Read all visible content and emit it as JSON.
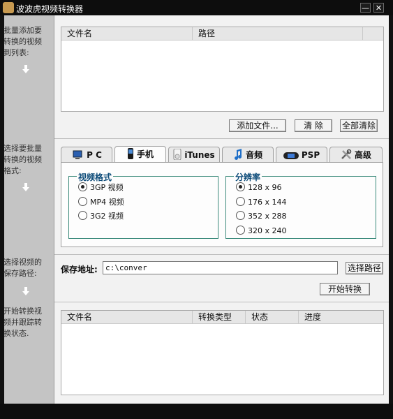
{
  "window": {
    "title": "波波虎视频转换器",
    "minimize_label": "—",
    "close_label": "✕"
  },
  "guide": {
    "step1": "批量添加要转换的视频到列表:",
    "step2": "选择要批量转换的视频格式:",
    "step3": "选择视频的保存路径:",
    "step4": "开始转换视频并跟踪转换状态."
  },
  "file_list": {
    "columns": [
      "文件名",
      "路径"
    ],
    "rows": []
  },
  "buttons": {
    "add_file": "添加文件...",
    "clear": "清  除",
    "clear_all": "全部清除",
    "choose_path": "选择路径",
    "start_convert": "开始转换"
  },
  "tabs": [
    {
      "label": "P C",
      "icon": "pc-icon"
    },
    {
      "label": "手机",
      "icon": "phone-icon"
    },
    {
      "label": "iTunes",
      "icon": "ipod-icon"
    },
    {
      "label": "音频",
      "icon": "music-note-icon"
    },
    {
      "label": "PSP",
      "icon": "psp-icon"
    },
    {
      "label": "高级",
      "icon": "tools-icon"
    }
  ],
  "active_tab": "手机",
  "video_format": {
    "title": "视频格式",
    "options": [
      "3GP 视频",
      "MP4 视频",
      "3G2 视频"
    ],
    "selected": "3GP 视频"
  },
  "resolution": {
    "title": "分辨率",
    "options": [
      "128 x 96",
      "176 x 144",
      "352 x 288",
      "320 x 240"
    ],
    "selected": "128 x 96"
  },
  "save": {
    "label": "保存地址:",
    "value": "c:\\conver"
  },
  "status_list": {
    "columns": [
      "文件名",
      "转换类型",
      "状态",
      "进度"
    ],
    "rows": []
  },
  "colors": {
    "titlebar": "#0d0d0d",
    "guide_panel": "#c4c4c4",
    "group_border": "#3a8a7a",
    "legend_text": "#0b4a78"
  }
}
